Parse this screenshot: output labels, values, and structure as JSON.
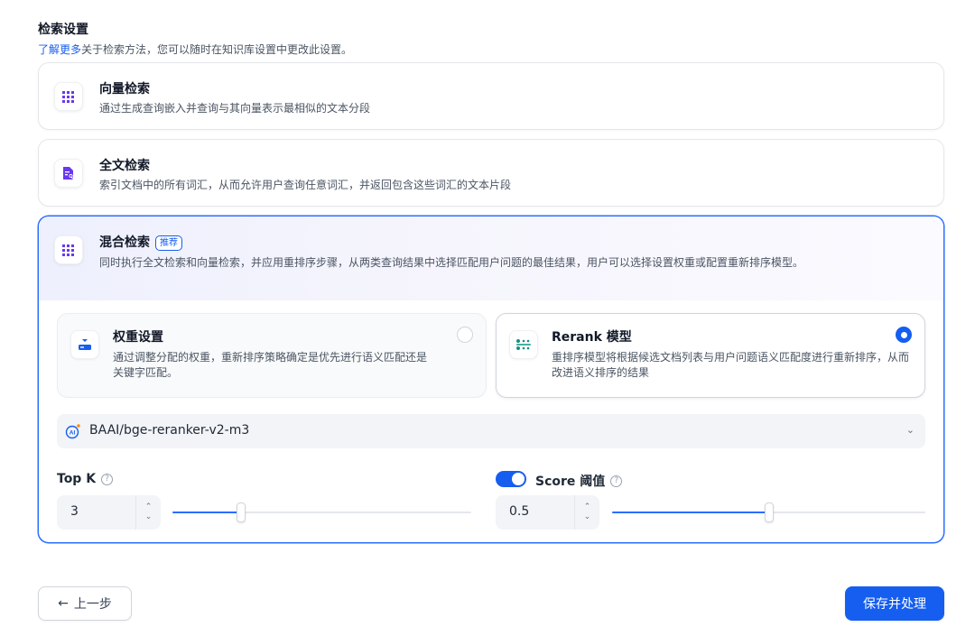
{
  "header": {
    "title": "检索设置",
    "learn_more": "了解更多",
    "description": "关于检索方法，您可以随时在知识库设置中更改此设置。"
  },
  "methods": {
    "vector": {
      "icon": "vector-grid-icon",
      "title": "向量检索",
      "description": "通过生成查询嵌入并查询与其向量表示最相似的文本分段"
    },
    "fulltext": {
      "icon": "document-search-icon",
      "title": "全文检索",
      "description": "索引文档中的所有词汇，从而允许用户查询任意词汇，并返回包含这些词汇的文本片段"
    },
    "hybrid": {
      "icon": "hybrid-grid-icon",
      "title": "混合检索",
      "badge": "推荐",
      "description": "同时执行全文检索和向量检索，并应用重排序步骤，从两类查询结果中选择匹配用户问题的最佳结果，用户可以选择设置权重或配置重新排序模型。",
      "selected": true
    }
  },
  "rerank_options": {
    "weight": {
      "icon": "weight-icon",
      "title": "权重设置",
      "description": "通过调整分配的权重，重新排序策略确定是优先进行语义匹配还是关键字匹配。",
      "selected": false
    },
    "rerank": {
      "icon": "rerank-icon",
      "title": "Rerank 模型",
      "description": "重排序模型将根据候选文档列表与用户问题语义匹配度进行重新排序，从而改进语义排序的结果",
      "selected": true
    }
  },
  "model_select": {
    "icon": "ai-model-icon",
    "value": "BAAI/bge-reranker-v2-m3"
  },
  "top_k": {
    "label": "Top K",
    "value": "3",
    "slider_fraction": 0.23
  },
  "score_threshold": {
    "label": "Score 阈值",
    "enabled": true,
    "value": "0.5",
    "slider_fraction": 0.5
  },
  "footer": {
    "back_label": "上一步",
    "save_label": "保存并处理"
  },
  "colors": {
    "primary": "#155eef",
    "selected_border": "#296dff",
    "icon_purple": "#6938ef"
  }
}
